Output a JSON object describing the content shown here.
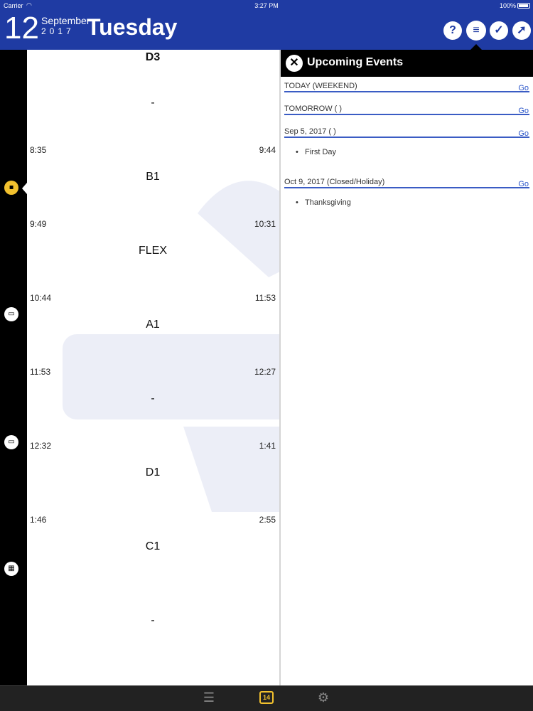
{
  "status_bar": {
    "carrier": "Carrier",
    "time": "3:27 PM",
    "battery": "100%"
  },
  "header": {
    "day_number": "12",
    "month": "September",
    "year": "2017",
    "weekday": "Tuesday",
    "icons": [
      "help-icon",
      "list-icon",
      "check-icon",
      "compass-icon"
    ],
    "color": "#1f3ba3"
  },
  "rail": {
    "icons": [
      "square-icon",
      "period-icon",
      "period-icon",
      "calendar-grid-icon"
    ]
  },
  "schedule": {
    "periods": [
      {
        "label": "D3",
        "start": "",
        "end": ""
      },
      {
        "label": "-",
        "start": "",
        "end": ""
      },
      {
        "label": "B1",
        "start": "8:35",
        "end": "9:44"
      },
      {
        "label": "FLEX",
        "start": "9:49",
        "end": "10:31"
      },
      {
        "label": "A1",
        "start": "10:44",
        "end": "11:53"
      },
      {
        "label": "-",
        "start": "11:53",
        "end": "12:27"
      },
      {
        "label": "D1",
        "start": "12:32",
        "end": "1:41"
      },
      {
        "label": "C1",
        "start": "1:46",
        "end": "2:55"
      },
      {
        "label": "-",
        "start": "",
        "end": ""
      }
    ]
  },
  "events": {
    "title": "Upcoming Events",
    "go_label": "Go",
    "items": [
      {
        "heading": "TODAY (WEEKEND)",
        "entries": []
      },
      {
        "heading": "TOMORROW ( )",
        "entries": []
      },
      {
        "heading": "Sep 5, 2017 ( )",
        "entries": [
          "First Day"
        ]
      },
      {
        "heading": "Oct 9, 2017 (Closed/Holiday)",
        "entries": [
          "Thanksgiving"
        ]
      }
    ]
  },
  "tabbar": {
    "calendar_badge": "14",
    "accent": "#f2c12e"
  }
}
